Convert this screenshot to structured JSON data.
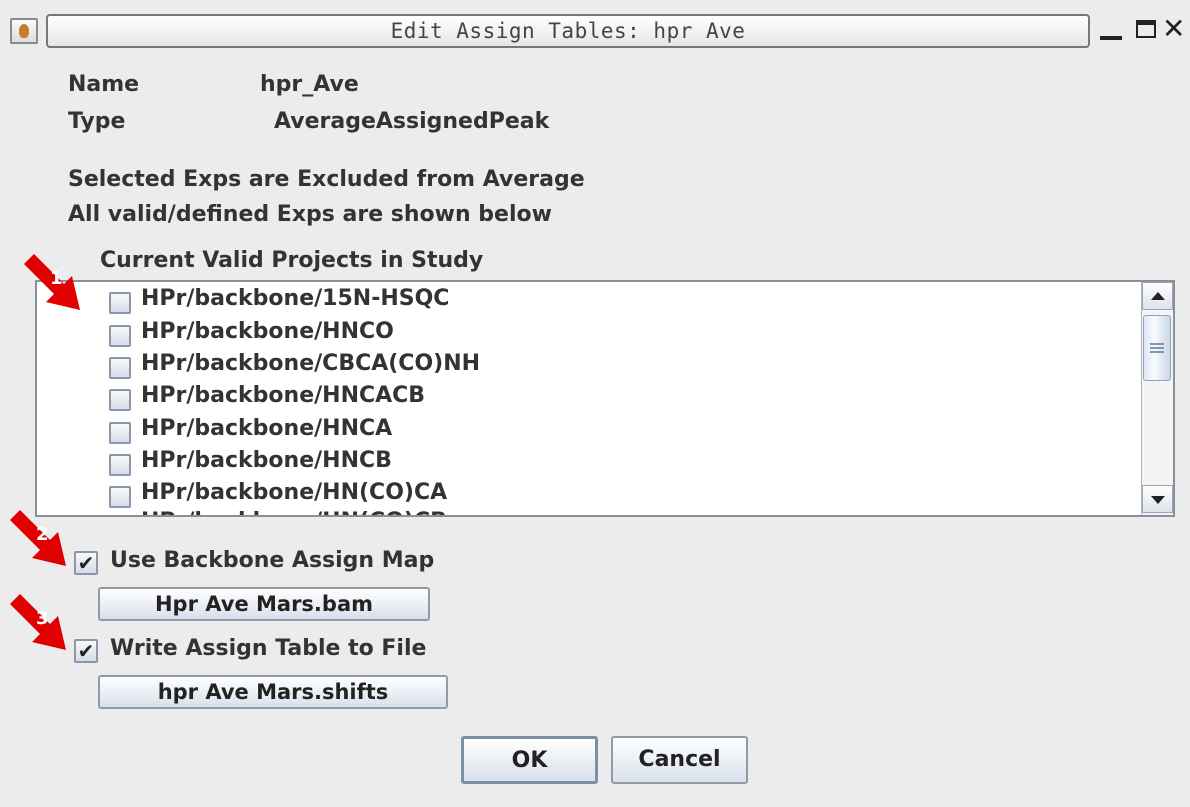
{
  "window": {
    "title": "Edit Assign Tables: hpr Ave"
  },
  "info": {
    "name_label": "Name",
    "name_value": "hpr_Ave",
    "type_label": "Type",
    "type_value": "AverageAssignedPeak"
  },
  "note": {
    "line1": "Selected Exps are Excluded from Average",
    "line2": "All valid/defined Exps are shown below"
  },
  "projects": {
    "label": "Current Valid Projects in Study",
    "items": [
      "HPr/backbone/15N-HSQC",
      "HPr/backbone/HNCO",
      "HPr/backbone/CBCA(CO)NH",
      "HPr/backbone/HNCACB",
      "HPr/backbone/HNCA",
      "HPr/backbone/HNCB",
      "HPr/backbone/HN(CO)CA",
      "HPr/backbone/HN(CO)CB"
    ]
  },
  "options": {
    "backbone_map": {
      "label": "Use Backbone Assign Map",
      "checked": true,
      "file": "Hpr Ave Mars.bam"
    },
    "write_table": {
      "label": "Write Assign Table to File",
      "checked": true,
      "file": "hpr Ave Mars.shifts"
    },
    "check_mark": "✔"
  },
  "buttons": {
    "ok": "OK",
    "cancel": "Cancel"
  },
  "annotations": {
    "a1": "1",
    "a2": "2",
    "a3": "3",
    "arrow_color": "#e00000"
  }
}
